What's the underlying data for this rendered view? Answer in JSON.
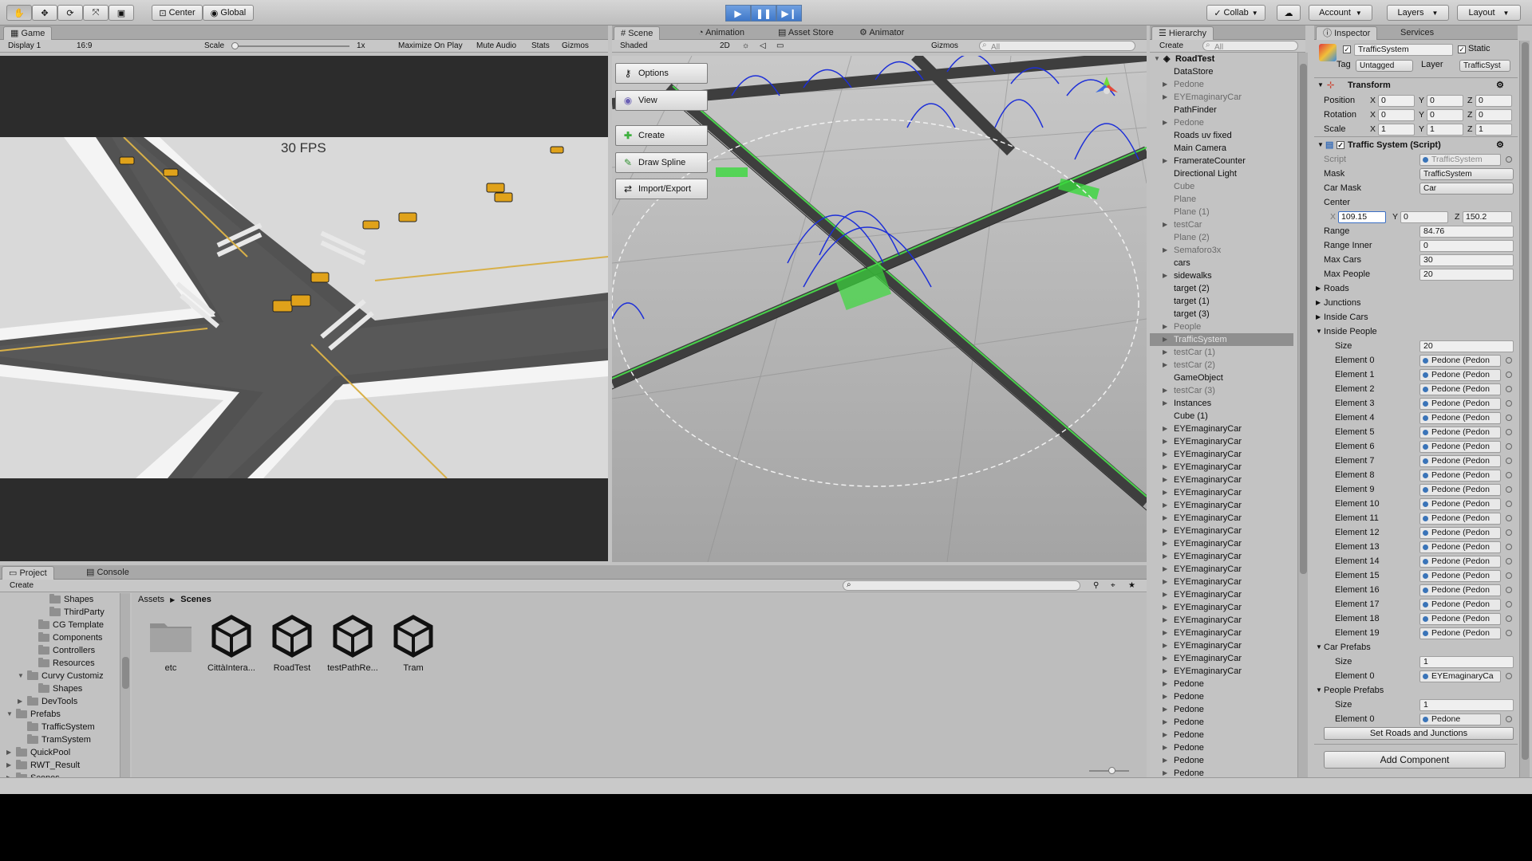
{
  "toolbar": {
    "pivot": "Center",
    "space": "Global",
    "collab": "Collab",
    "account": "Account",
    "layers": "Layers",
    "layout": "Layout"
  },
  "game": {
    "tab": "Game",
    "display": "Display 1",
    "aspect": "16:9",
    "scale_label": "Scale",
    "scale_value": "1x",
    "maximize": "Maximize On Play",
    "mute": "Mute Audio",
    "stats": "Stats",
    "gizmos": "Gizmos",
    "fps": "30 FPS"
  },
  "scene": {
    "tabs": [
      "Scene",
      "Animation",
      "Asset Store",
      "Animator"
    ],
    "shading": "Shaded",
    "mode2d": "2D",
    "gizmos": "Gizmos",
    "search_placeholder": "All",
    "buttons": [
      "Options",
      "View",
      "Create",
      "Draw Spline",
      "Import/Export"
    ]
  },
  "hierarchy": {
    "tab": "Hierarchy",
    "create": "Create",
    "search_placeholder": "All",
    "root": "RoadTest",
    "items": [
      {
        "label": "DataStore",
        "arrow": false,
        "grey": false
      },
      {
        "label": "Pedone",
        "arrow": true,
        "grey": true
      },
      {
        "label": "EYEmaginaryCar",
        "arrow": true,
        "grey": true
      },
      {
        "label": "PathFinder",
        "arrow": false,
        "grey": false
      },
      {
        "label": "Pedone",
        "arrow": true,
        "grey": true
      },
      {
        "label": "Roads uv fixed",
        "arrow": false,
        "grey": false
      },
      {
        "label": "Main Camera",
        "arrow": false,
        "grey": false
      },
      {
        "label": "FramerateCounter",
        "arrow": true,
        "grey": false
      },
      {
        "label": "Directional Light",
        "arrow": false,
        "grey": false
      },
      {
        "label": "Cube",
        "arrow": false,
        "grey": true
      },
      {
        "label": "Plane",
        "arrow": false,
        "grey": true
      },
      {
        "label": "Plane (1)",
        "arrow": false,
        "grey": true
      },
      {
        "label": "testCar",
        "arrow": true,
        "grey": true
      },
      {
        "label": "Plane (2)",
        "arrow": false,
        "grey": true
      },
      {
        "label": "Semaforo3x",
        "arrow": true,
        "grey": true
      },
      {
        "label": "cars",
        "arrow": false,
        "grey": false
      },
      {
        "label": "sidewalks",
        "arrow": true,
        "grey": false
      },
      {
        "label": "target (2)",
        "arrow": false,
        "grey": false
      },
      {
        "label": "target (1)",
        "arrow": false,
        "grey": false
      },
      {
        "label": "target (3)",
        "arrow": false,
        "grey": false
      },
      {
        "label": "People",
        "arrow": true,
        "grey": true
      },
      {
        "label": "TrafficSystem",
        "arrow": true,
        "grey": false,
        "selected": true
      },
      {
        "label": "testCar (1)",
        "arrow": true,
        "grey": true
      },
      {
        "label": "testCar (2)",
        "arrow": true,
        "grey": true
      },
      {
        "label": "GameObject",
        "arrow": false,
        "grey": false
      },
      {
        "label": "testCar (3)",
        "arrow": true,
        "grey": true
      },
      {
        "label": "Instances",
        "arrow": true,
        "grey": false
      },
      {
        "label": "Cube (1)",
        "arrow": false,
        "grey": false
      },
      {
        "label": "EYEmaginaryCar",
        "arrow": true,
        "grey": false
      },
      {
        "label": "EYEmaginaryCar",
        "arrow": true,
        "grey": false
      },
      {
        "label": "EYEmaginaryCar",
        "arrow": true,
        "grey": false
      },
      {
        "label": "EYEmaginaryCar",
        "arrow": true,
        "grey": false
      },
      {
        "label": "EYEmaginaryCar",
        "arrow": true,
        "grey": false
      },
      {
        "label": "EYEmaginaryCar",
        "arrow": true,
        "grey": false
      },
      {
        "label": "EYEmaginaryCar",
        "arrow": true,
        "grey": false
      },
      {
        "label": "EYEmaginaryCar",
        "arrow": true,
        "grey": false
      },
      {
        "label": "EYEmaginaryCar",
        "arrow": true,
        "grey": false
      },
      {
        "label": "EYEmaginaryCar",
        "arrow": true,
        "grey": false
      },
      {
        "label": "EYEmaginaryCar",
        "arrow": true,
        "grey": false
      },
      {
        "label": "EYEmaginaryCar",
        "arrow": true,
        "grey": false
      },
      {
        "label": "EYEmaginaryCar",
        "arrow": true,
        "grey": false
      },
      {
        "label": "EYEmaginaryCar",
        "arrow": true,
        "grey": false
      },
      {
        "label": "EYEmaginaryCar",
        "arrow": true,
        "grey": false
      },
      {
        "label": "EYEmaginaryCar",
        "arrow": true,
        "grey": false
      },
      {
        "label": "EYEmaginaryCar",
        "arrow": true,
        "grey": false
      },
      {
        "label": "EYEmaginaryCar",
        "arrow": true,
        "grey": false
      },
      {
        "label": "EYEmaginaryCar",
        "arrow": true,
        "grey": false
      },
      {
        "label": "EYEmaginaryCar",
        "arrow": true,
        "grey": false
      },
      {
        "label": "Pedone",
        "arrow": true,
        "grey": false
      },
      {
        "label": "Pedone",
        "arrow": true,
        "grey": false
      },
      {
        "label": "Pedone",
        "arrow": true,
        "grey": false
      },
      {
        "label": "Pedone",
        "arrow": true,
        "grey": false
      },
      {
        "label": "Pedone",
        "arrow": true,
        "grey": false
      },
      {
        "label": "Pedone",
        "arrow": true,
        "grey": false
      },
      {
        "label": "Pedone",
        "arrow": true,
        "grey": false
      },
      {
        "label": "Pedone",
        "arrow": true,
        "grey": false
      },
      {
        "label": "Pedone",
        "arrow": true,
        "grey": false
      }
    ]
  },
  "inspector": {
    "tabs": [
      "Inspector",
      "Services"
    ],
    "object_name": "TrafficSystem",
    "static_label": "Static",
    "tag_label": "Tag",
    "tag_value": "Untagged",
    "layer_label": "Layer",
    "layer_value": "TrafficSyst",
    "transform": {
      "title": "Transform",
      "rows": [
        {
          "label": "Position",
          "x": "0",
          "y": "0",
          "z": "0"
        },
        {
          "label": "Rotation",
          "x": "0",
          "y": "0",
          "z": "0"
        },
        {
          "label": "Scale",
          "x": "1",
          "y": "1",
          "z": "1"
        }
      ]
    },
    "component": {
      "title": "Traffic System (Script)",
      "script_label": "Script",
      "script_value": "TrafficSystem",
      "mask_label": "Mask",
      "mask_value": "TrafficSystem",
      "car_mask_label": "Car Mask",
      "car_mask_value": "Car",
      "center_label": "Center",
      "center_x": "109.15",
      "center_y": "0",
      "center_z": "150.2",
      "range_label": "Range",
      "range_value": "84.76",
      "range_inner_label": "Range Inner",
      "range_inner_value": "0",
      "max_cars_label": "Max Cars",
      "max_cars_value": "30",
      "max_people_label": "Max People",
      "max_people_value": "20",
      "roads_label": "Roads",
      "junctions_label": "Junctions",
      "inside_cars_label": "Inside Cars",
      "inside_people_label": "Inside People",
      "size_label": "Size",
      "size_value": "20",
      "elements": [
        "Element 0",
        "Element 1",
        "Element 2",
        "Element 3",
        "Element 4",
        "Element 5",
        "Element 6",
        "Element 7",
        "Element 8",
        "Element 9",
        "Element 10",
        "Element 11",
        "Element 12",
        "Element 13",
        "Element 14",
        "Element 15",
        "Element 16",
        "Element 17",
        "Element 18",
        "Element 19"
      ],
      "element_value": "Pedone (Pedon",
      "car_prefabs_label": "Car Prefabs",
      "car_prefabs_size": "1",
      "car_prefab_element": "Element 0",
      "car_prefab_value": "EYEmaginaryCa",
      "people_prefabs_label": "People Prefabs",
      "people_prefabs_size": "1",
      "people_prefab_element": "Element 0",
      "people_prefab_value": "Pedone",
      "set_roads_button": "Set Roads and Junctions"
    },
    "add_component": "Add Component"
  },
  "project": {
    "tabs": [
      "Project",
      "Console"
    ],
    "create": "Create",
    "breadcrumb_root": "Assets",
    "breadcrumb_current": "Scenes",
    "tree": [
      {
        "label": "Shapes",
        "indent": 4,
        "arrow": ""
      },
      {
        "label": "ThirdParty",
        "indent": 4,
        "arrow": ""
      },
      {
        "label": "CG Template",
        "indent": 3,
        "arrow": ""
      },
      {
        "label": "Components",
        "indent": 3,
        "arrow": ""
      },
      {
        "label": "Controllers",
        "indent": 3,
        "arrow": ""
      },
      {
        "label": "Resources",
        "indent": 3,
        "arrow": ""
      },
      {
        "label": "Curvy Customiz",
        "indent": 2,
        "arrow": "▼"
      },
      {
        "label": "Shapes",
        "indent": 3,
        "arrow": ""
      },
      {
        "label": "DevTools",
        "indent": 2,
        "arrow": "▶"
      },
      {
        "label": "Prefabs",
        "indent": 1,
        "arrow": "▼"
      },
      {
        "label": "TrafficSystem",
        "indent": 2,
        "arrow": ""
      },
      {
        "label": "TramSystem",
        "indent": 2,
        "arrow": ""
      },
      {
        "label": "QuickPool",
        "indent": 1,
        "arrow": "▶"
      },
      {
        "label": "RWT_Result",
        "indent": 1,
        "arrow": "▶"
      },
      {
        "label": "Scenes",
        "indent": 1,
        "arrow": "▶"
      }
    ],
    "assets": [
      {
        "label": "etc",
        "kind": "folder"
      },
      {
        "label": "CittàIntera...",
        "kind": "unity"
      },
      {
        "label": "RoadTest",
        "kind": "unity"
      },
      {
        "label": "testPathRe...",
        "kind": "unity"
      },
      {
        "label": "Tram",
        "kind": "unity"
      }
    ]
  }
}
